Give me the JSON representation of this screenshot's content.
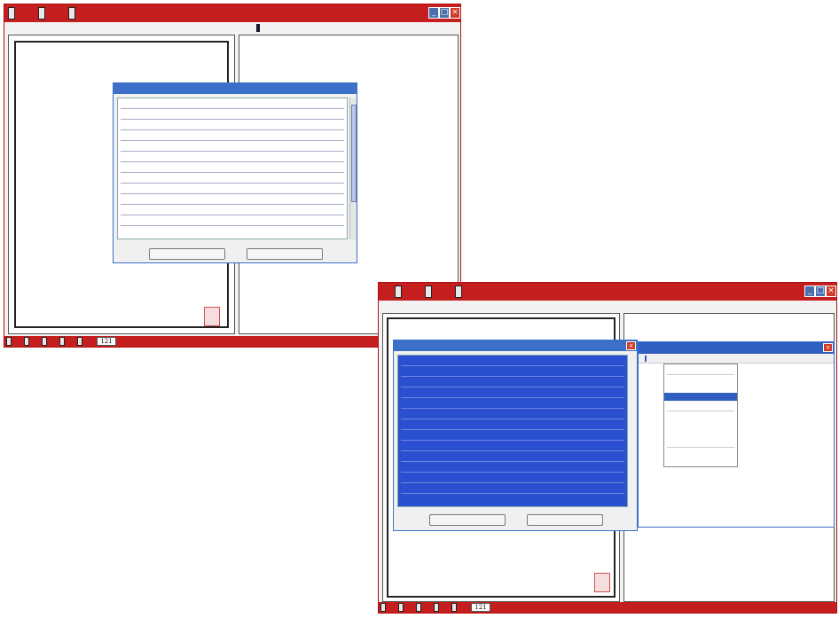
{
  "app1": {
    "toolbar": {
      "btn1": "",
      "btn2": "",
      "btn3": ""
    },
    "left_menu": {
      "item1": "",
      "item2": "",
      "item3": "",
      "item4": ""
    },
    "right_menu": {
      "item1": "",
      "item2": "",
      "item3": "",
      "item4": "",
      "item5": ""
    },
    "left_page": {
      "columns": [
        {
          "text": ""
        },
        {
          "text": ""
        },
        {
          "text": ""
        },
        {
          "text": ""
        },
        {
          "text": ""
        },
        {
          "text": ""
        },
        {
          "text": ""
        },
        {
          "text": ""
        },
        {
          "text": ""
        },
        {
          "text": ""
        },
        {
          "text": ""
        },
        {
          "text": ""
        }
      ]
    },
    "right_text": {
      "columns": [
        {
          "text": ""
        },
        {
          "text": ""
        },
        {
          "text": ""
        },
        {
          "text": ""
        },
        {
          "text": ""
        },
        {
          "text": ""
        },
        {
          "text": ""
        },
        {
          "text": ""
        },
        {
          "text": ""
        },
        {
          "text": ""
        },
        {
          "text": ""
        }
      ]
    },
    "bottom": {
      "btn_first": "",
      "btn_prev": "",
      "btn_next": "",
      "btn_last": "",
      "btn_goto": "",
      "page_number": "121",
      "page_total": "",
      "status_text": ""
    },
    "dialog": {
      "title": "",
      "source_label": "",
      "source_text": "",
      "copyist_label": "",
      "body_text": "",
      "btn_copy": "",
      "btn_close": ""
    }
  },
  "app2": {
    "toolbar": {
      "btn1": "",
      "btn2": "",
      "btn3": ""
    },
    "left_menu": {
      "item1": "",
      "item2": "",
      "item3": "",
      "item4": ""
    },
    "right_menu": {
      "item1": "",
      "item2": "",
      "item3": "",
      "item4": "",
      "item5": ""
    },
    "right_text": {
      "columns": [
        {
          "text": ""
        },
        {
          "text": ""
        },
        {
          "text": ""
        },
        {
          "text": ""
        },
        {
          "text": ""
        },
        {
          "text": ""
        },
        {
          "text": ""
        },
        {
          "text": ""
        },
        {
          "text": ""
        },
        {
          "text": ""
        }
      ]
    },
    "bottom": {
      "btn_first": "",
      "btn_prev": "",
      "btn_next": "",
      "btn_last": "",
      "btn_goto": "",
      "page_number": "121",
      "page_total": "",
      "status_text": ""
    },
    "dialog": {
      "title": "",
      "source_text": "",
      "copyist_label": "",
      "body_text": "",
      "btn_copy": "",
      "btn_close": ""
    },
    "notepad": {
      "title": "",
      "menu": {
        "file": "",
        "edit": "",
        "format": "",
        "view": "",
        "help": ""
      },
      "edit_menu": [
        {
          "label": "",
          "shortcut": ""
        },
        {
          "label": "",
          "shortcut": ""
        },
        {
          "label": "",
          "shortcut": ""
        },
        {
          "label": "",
          "shortcut": ""
        },
        {
          "label": "",
          "shortcut": ""
        },
        {
          "label": "",
          "shortcut": ""
        },
        {
          "label": "",
          "shortcut": ""
        },
        {
          "label": "",
          "shortcut": ""
        },
        {
          "label": "",
          "shortcut": ""
        },
        {
          "label": "",
          "shortcut": ""
        },
        {
          "label": "",
          "shortcut": ""
        }
      ],
      "content": ""
    }
  },
  "colors": {
    "accent_red": "#c41e1e",
    "dialog_blue": "#3b6fc8",
    "selection_blue": "#2a4fd0"
  }
}
